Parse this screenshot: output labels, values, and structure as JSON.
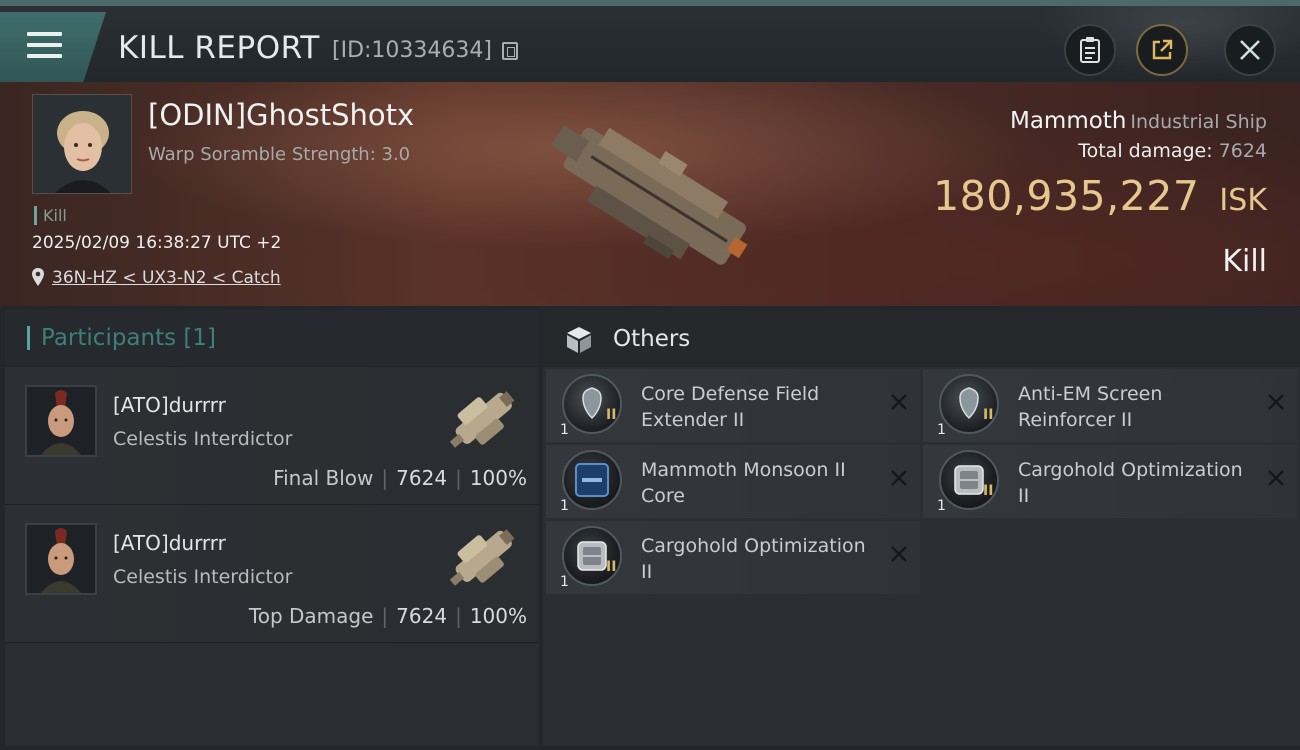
{
  "header": {
    "title": "KILL REPORT",
    "report_id": "[ID:10334634]"
  },
  "victim": {
    "name": "[ODIN]GhostShotx",
    "subtitle": "Warp Soramble Strength: 3.0",
    "tag": "Kill",
    "date": "2025/02/09 16:38:27 UTC +2",
    "location": "36N-HZ < UX3-N2 < Catch"
  },
  "ship": {
    "name": "Mammoth",
    "class": "Industrial Ship",
    "total_damage_label": "Total damage:",
    "total_damage": "7624",
    "isk_value": "180,935,227",
    "isk_unit": "ISK",
    "result": "Kill"
  },
  "participants": {
    "title": "Participants [1]",
    "rows": [
      {
        "name": "[ATO]durrrr",
        "ship": "Celestis Interdictor",
        "label": "Final Blow",
        "damage": "7624",
        "percent": "100%"
      },
      {
        "name": "[ATO]durrrr",
        "ship": "Celestis Interdictor",
        "label": "Top Damage",
        "damage": "7624",
        "percent": "100%"
      }
    ]
  },
  "others": {
    "title": "Others",
    "items": [
      {
        "name": "Core Defense Field Extender II",
        "qty": "1",
        "tier": "II",
        "icon": "shield-extender-icon"
      },
      {
        "name": "Anti-EM Screen Reinforcer II",
        "qty": "1",
        "tier": "II",
        "icon": "shield-rig-icon"
      },
      {
        "name": "Mammoth Monsoon II Core",
        "qty": "1",
        "tier": "",
        "icon": "core-chip-icon"
      },
      {
        "name": "Cargohold Optimization II",
        "qty": "1",
        "tier": "II",
        "icon": "cargo-rig-icon"
      },
      {
        "name": "Cargohold Optimization II",
        "qty": "1",
        "tier": "II",
        "icon": "cargo-rig-icon"
      }
    ]
  },
  "colors": {
    "accent_teal": "#5aa39b",
    "isk_gold": "#e6c88f",
    "tier_gold": "#d8b86a"
  }
}
